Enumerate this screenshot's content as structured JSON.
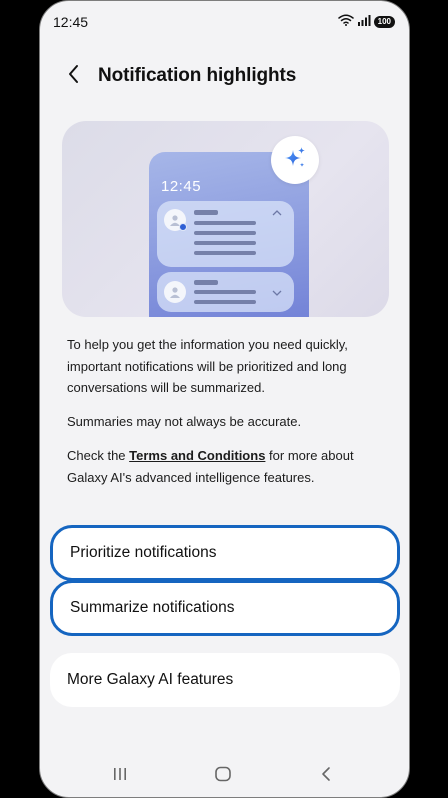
{
  "status": {
    "time": "12:45",
    "battery": "100",
    "icons": [
      "wifi-icon",
      "signal-icon",
      "battery-icon"
    ]
  },
  "header": {
    "back_icon": "chevron-left-icon",
    "title": "Notification highlights"
  },
  "hero": {
    "mock_time": "12:45",
    "sparkle_icon": "sparkle-icon"
  },
  "description": {
    "p1": "To help you get the information you need quickly, important notifications will be prioritized and long conversations will be summarized.",
    "p2": "Summaries may not always be accurate.",
    "p3_before": "Check the ",
    "p3_link": "Terms and Conditions",
    "p3_after": " for more about Galaxy AI's advanced intelligence features."
  },
  "options": {
    "prioritize": "Prioritize notifications",
    "summarize": "Summarize notifications",
    "more": "More Galaxy AI features"
  },
  "nav": {
    "icons": [
      "recents-icon",
      "home-icon",
      "back-icon"
    ]
  },
  "colors": {
    "accent": "#1565c0",
    "background": "#f3f3f5",
    "card": "#ffffff"
  }
}
